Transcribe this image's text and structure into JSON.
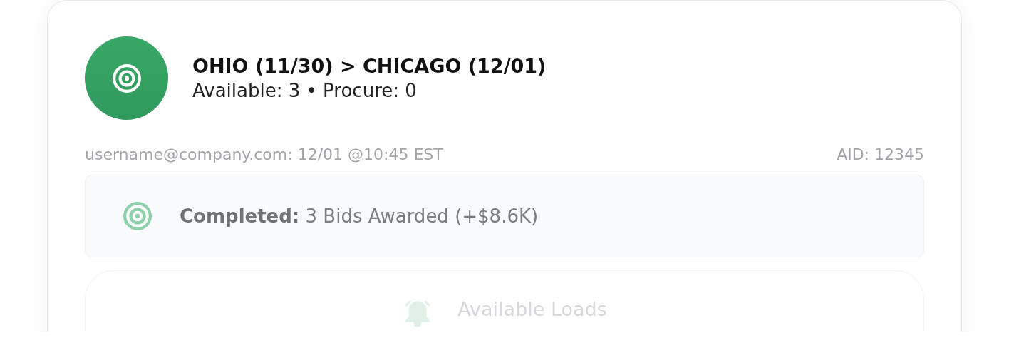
{
  "lane": {
    "title": "OHIO (11/30) > CHICAGO (12/01)",
    "subtitle": "Available: 3 • Procure: 0"
  },
  "meta": {
    "author": "username@company.com: 12/01 @10:45 EST",
    "aid": "AID: 12345"
  },
  "status": {
    "text": "**Completed:** 3 Bids Awarded (+$8.6K)"
  },
  "section": {
    "title": "Available Loads"
  }
}
